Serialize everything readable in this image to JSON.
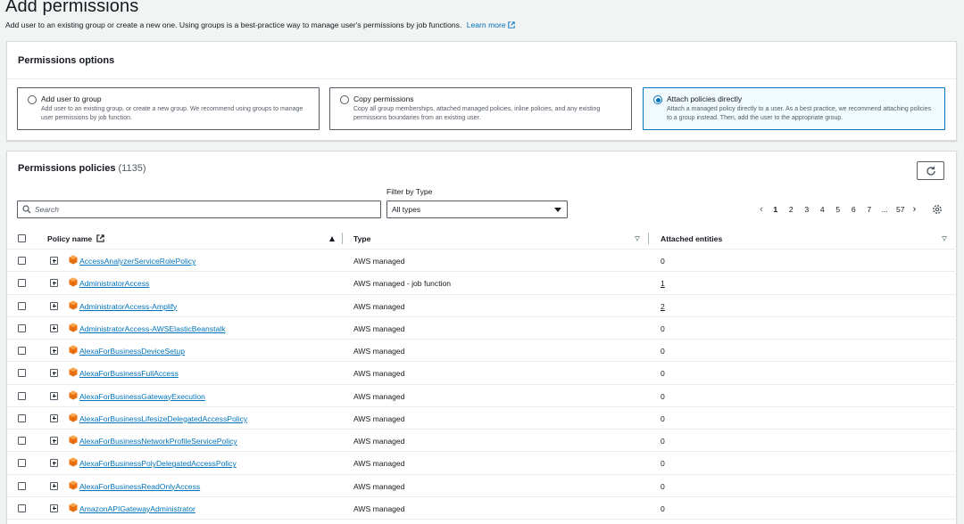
{
  "page": {
    "title": "Add permissions",
    "description": "Add user to an existing group or create a new one. Using groups is a best-practice way to manage user's permissions by job functions.",
    "learn_more": "Learn more"
  },
  "options_panel": {
    "title": "Permissions options",
    "options": [
      {
        "title": "Add user to group",
        "description": "Add user to an existing group, or create a new group. We recommend using groups to manage user permissions by job function.",
        "selected": false
      },
      {
        "title": "Copy permissions",
        "description": "Copy all group memberships, attached managed policies, inline policies, and any existing permissions boundaries from an existing user.",
        "selected": false
      },
      {
        "title": "Attach policies directly",
        "description": "Attach a managed policy directly to a user. As a best practice, we recommend attaching policies to a group instead. Then, add the user to the appropriate group.",
        "selected": true
      }
    ]
  },
  "policies_panel": {
    "title": "Permissions policies",
    "count": "(1135)",
    "filter_label": "Filter by Type",
    "search_placeholder": "Search",
    "filter_value": "All types",
    "pagination": {
      "prev": "‹",
      "pages": [
        "1",
        "2",
        "3",
        "4",
        "5",
        "6",
        "7",
        "...",
        "57"
      ],
      "current": "1",
      "next": "›"
    },
    "columns": {
      "name": "Policy name",
      "type": "Type",
      "entities": "Attached entities"
    },
    "rows": [
      {
        "name": "AccessAnalyzerServiceRolePolicy",
        "type": "AWS managed",
        "entities": "0"
      },
      {
        "name": "AdministratorAccess",
        "type": "AWS managed - job function",
        "entities": "1"
      },
      {
        "name": "AdministratorAccess-Amplify",
        "type": "AWS managed",
        "entities": "2"
      },
      {
        "name": "AdministratorAccess-AWSElasticBeanstalk",
        "type": "AWS managed",
        "entities": "0"
      },
      {
        "name": "AlexaForBusinessDeviceSetup",
        "type": "AWS managed",
        "entities": "0"
      },
      {
        "name": "AlexaForBusinessFullAccess",
        "type": "AWS managed",
        "entities": "0"
      },
      {
        "name": "AlexaForBusinessGatewayExecution",
        "type": "AWS managed",
        "entities": "0"
      },
      {
        "name": "AlexaForBusinessLifesizeDelegatedAccessPolicy",
        "type": "AWS managed",
        "entities": "0"
      },
      {
        "name": "AlexaForBusinessNetworkProfileServicePolicy",
        "type": "AWS managed",
        "entities": "0"
      },
      {
        "name": "AlexaForBusinessPolyDelegatedAccessPolicy",
        "type": "AWS managed",
        "entities": "0"
      },
      {
        "name": "AlexaForBusinessReadOnlyAccess",
        "type": "AWS managed",
        "entities": "0"
      },
      {
        "name": "AmazonAPIGatewayAdministrator",
        "type": "AWS managed",
        "entities": "0"
      }
    ]
  },
  "colors": {
    "link": "#0073bb",
    "selected_bg": "#f1faff",
    "policy_icon": "#ec7211"
  }
}
